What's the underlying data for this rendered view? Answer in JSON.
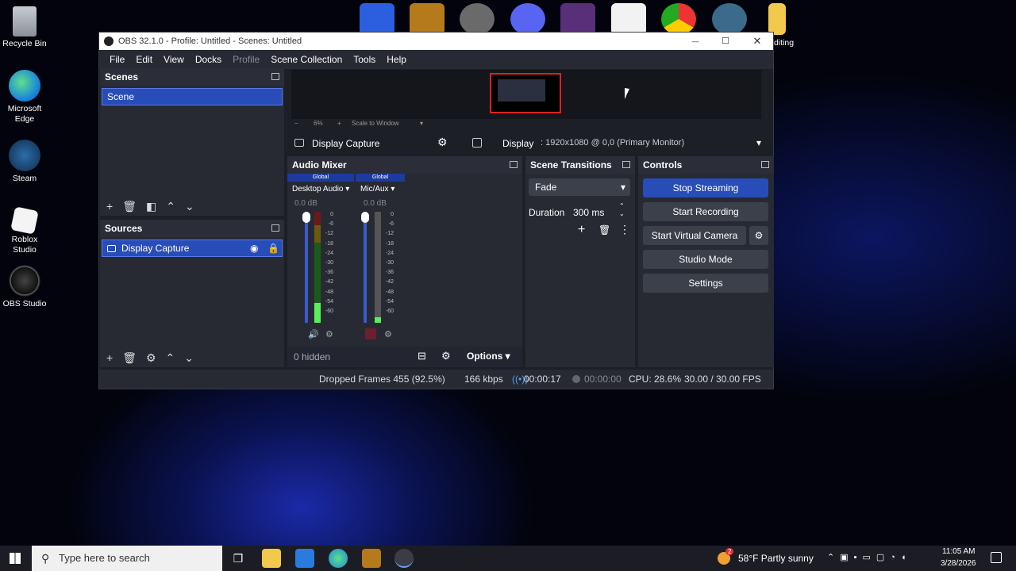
{
  "desktop": {
    "icons": [
      {
        "label": "Recycle Bin"
      },
      {
        "label": "Microsoft Edge"
      },
      {
        "label": "Steam"
      },
      {
        "label": "Roblox Studio"
      },
      {
        "label": "OBS Studio"
      }
    ],
    "partial_label": "diting"
  },
  "window": {
    "title": "OBS 32.1.0 - Profile: Untitled - Scenes: Untitled",
    "minimize": "—",
    "maximize": "☐",
    "close": "✕"
  },
  "menu": [
    "File",
    "Edit",
    "View",
    "Docks",
    "Profile",
    "Scene Collection",
    "Tools",
    "Help"
  ],
  "preview": {
    "zoom_minus": "−",
    "zoom": "6%",
    "zoom_plus": "+",
    "scale_mode": "Scale to Window"
  },
  "scenes": {
    "title": "Scenes",
    "items": [
      "Scene"
    ]
  },
  "sources": {
    "title": "Sources",
    "items": [
      "Display Capture"
    ]
  },
  "source_bar": {
    "name": "Display Capture",
    "display_label": "Display",
    "display_value": ": 1920x1080 @ 0,0 (Primary Monitor)"
  },
  "audio_mixer": {
    "title": "Audio Mixer",
    "channels": [
      {
        "tag": "Global",
        "name": "Desktop Audio",
        "db": "0.0 dB",
        "level": 0.18
      },
      {
        "tag": "Global",
        "name": "Mic/Aux",
        "db": "0.0 dB",
        "level": 0.05
      }
    ],
    "scale": [
      "0",
      "-6",
      "-12",
      "-18",
      "-24",
      "-30",
      "-36",
      "-42",
      "-48",
      "-54",
      "-60"
    ],
    "hidden": "0 hidden",
    "options": "Options"
  },
  "transitions": {
    "title": "Scene Transitions",
    "value": "Fade",
    "duration_label": "Duration",
    "duration_value": "300 ms"
  },
  "controls": {
    "title": "Controls",
    "stop_streaming": "Stop Streaming",
    "start_recording": "Start Recording",
    "start_virtual_camera": "Start Virtual Camera",
    "studio_mode": "Studio Mode",
    "settings": "Settings"
  },
  "status": {
    "dropped": "Dropped Frames 455 (92.5%)",
    "bitrate": "166 kbps",
    "stream_time": "00:00:17",
    "rec_time": "00:00:00",
    "cpu": "CPU: 28.6%",
    "fps": "30.00 / 30.00 FPS"
  },
  "taskbar": {
    "search_placeholder": "Type here to search",
    "weather": "58°F  Partly sunny",
    "time": "11:05 AM",
    "date": "3/28/2026",
    "badge": "2"
  },
  "colors": {
    "accent": "#284cb8",
    "panel": "#272a33",
    "bg": "#1d1f26"
  }
}
